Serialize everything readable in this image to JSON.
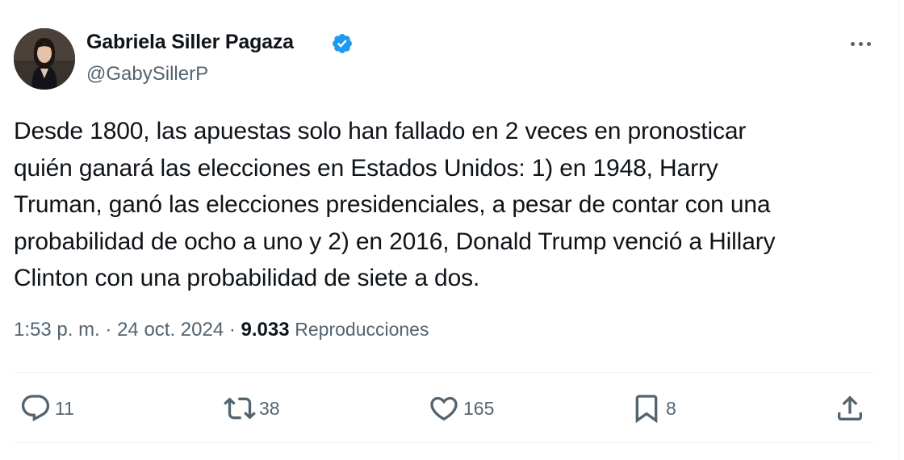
{
  "author": {
    "display_name": "Gabriela Siller Pagaza",
    "handle": "@GabySillerP",
    "verified": true,
    "verified_color": "#1d9bf0"
  },
  "tweet": {
    "lines": [
      "Desde 1800, las apuestas solo han fallado en 2 veces en pronosticar",
      "quién ganará las elecciones en Estados Unidos: 1) en 1948, Harry",
      "Truman, ganó las elecciones presidenciales, a pesar de contar con una",
      "probabilidad de ocho a uno y 2) en 2016, Donald Trump venció a Hillary",
      "Clinton con una probabilidad de siete a dos."
    ]
  },
  "meta": {
    "time": "1:53 p. m.",
    "separator": "·",
    "date": "24 oct. 2024",
    "views_count": "9.033",
    "views_label": "Reproducciones"
  },
  "actions": {
    "reply": {
      "icon": "reply-icon",
      "count": "11"
    },
    "retweet": {
      "icon": "retweet-icon",
      "count": "38"
    },
    "like": {
      "icon": "heart-icon",
      "count": "165"
    },
    "bookmark": {
      "icon": "bookmark-icon",
      "count": "8"
    },
    "share": {
      "icon": "share-icon"
    }
  },
  "colors": {
    "text": "#0f1419",
    "secondary": "#536471",
    "divider": "#eff3f4"
  }
}
